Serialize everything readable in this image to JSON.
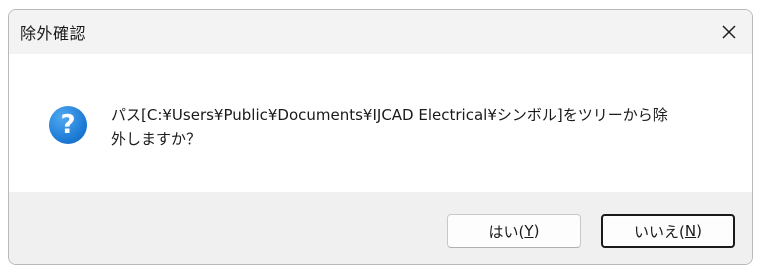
{
  "dialog": {
    "title": "除外確認",
    "close_icon": "close-icon",
    "question_icon": "question-icon",
    "question_glyph": "?",
    "message": "パス[C:¥Users¥Public¥Documents¥IJCAD Electrical¥シンボル]をツリーから除\n外しますか？",
    "buttons": {
      "yes": {
        "label_main": "はい(",
        "mnemonic": "Y",
        "label_end": ")"
      },
      "no": {
        "label_main": "いいえ(",
        "mnemonic": "N",
        "label_end": ")"
      }
    },
    "colors": {
      "icon_blue": "#1976d2",
      "titlebar": "#f3f3f3",
      "footer": "#f0f0f0"
    }
  }
}
